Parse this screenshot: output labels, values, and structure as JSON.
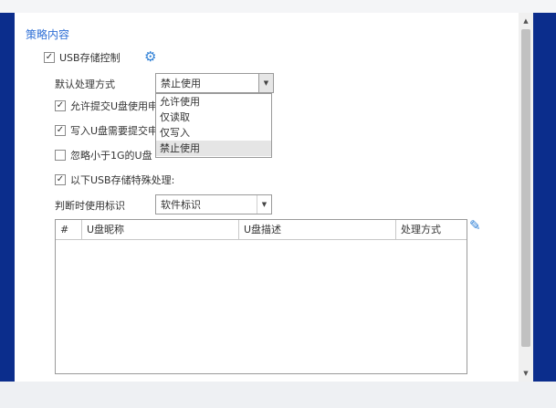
{
  "section_title": "策略内容",
  "usb_control": {
    "label": "USB存储控制",
    "checked": true
  },
  "default_action": {
    "label": "默认处理方式",
    "value": "禁止使用",
    "options": [
      "允许使用",
      "仅读取",
      "仅写入",
      "禁止使用"
    ],
    "selected_index": 3
  },
  "options": [
    {
      "label": "允许提交U盘使用申",
      "checked": true
    },
    {
      "label": "写入U盘需要提交申",
      "checked": true
    },
    {
      "label": "忽略小于1G的U盘",
      "checked": false
    },
    {
      "label": "以下USB存储特殊处理:",
      "checked": true
    }
  ],
  "identifier": {
    "label": "判断时使用标识",
    "value": "软件标识"
  },
  "table": {
    "columns": [
      "#",
      "U盘昵称",
      "U盘描述",
      "处理方式"
    ],
    "rows": []
  },
  "icons": {
    "settings": "gear-icon",
    "edit": "pencil-icon"
  },
  "colors": {
    "accent": "#2f6fd6",
    "frame": "#0b2d8c"
  }
}
